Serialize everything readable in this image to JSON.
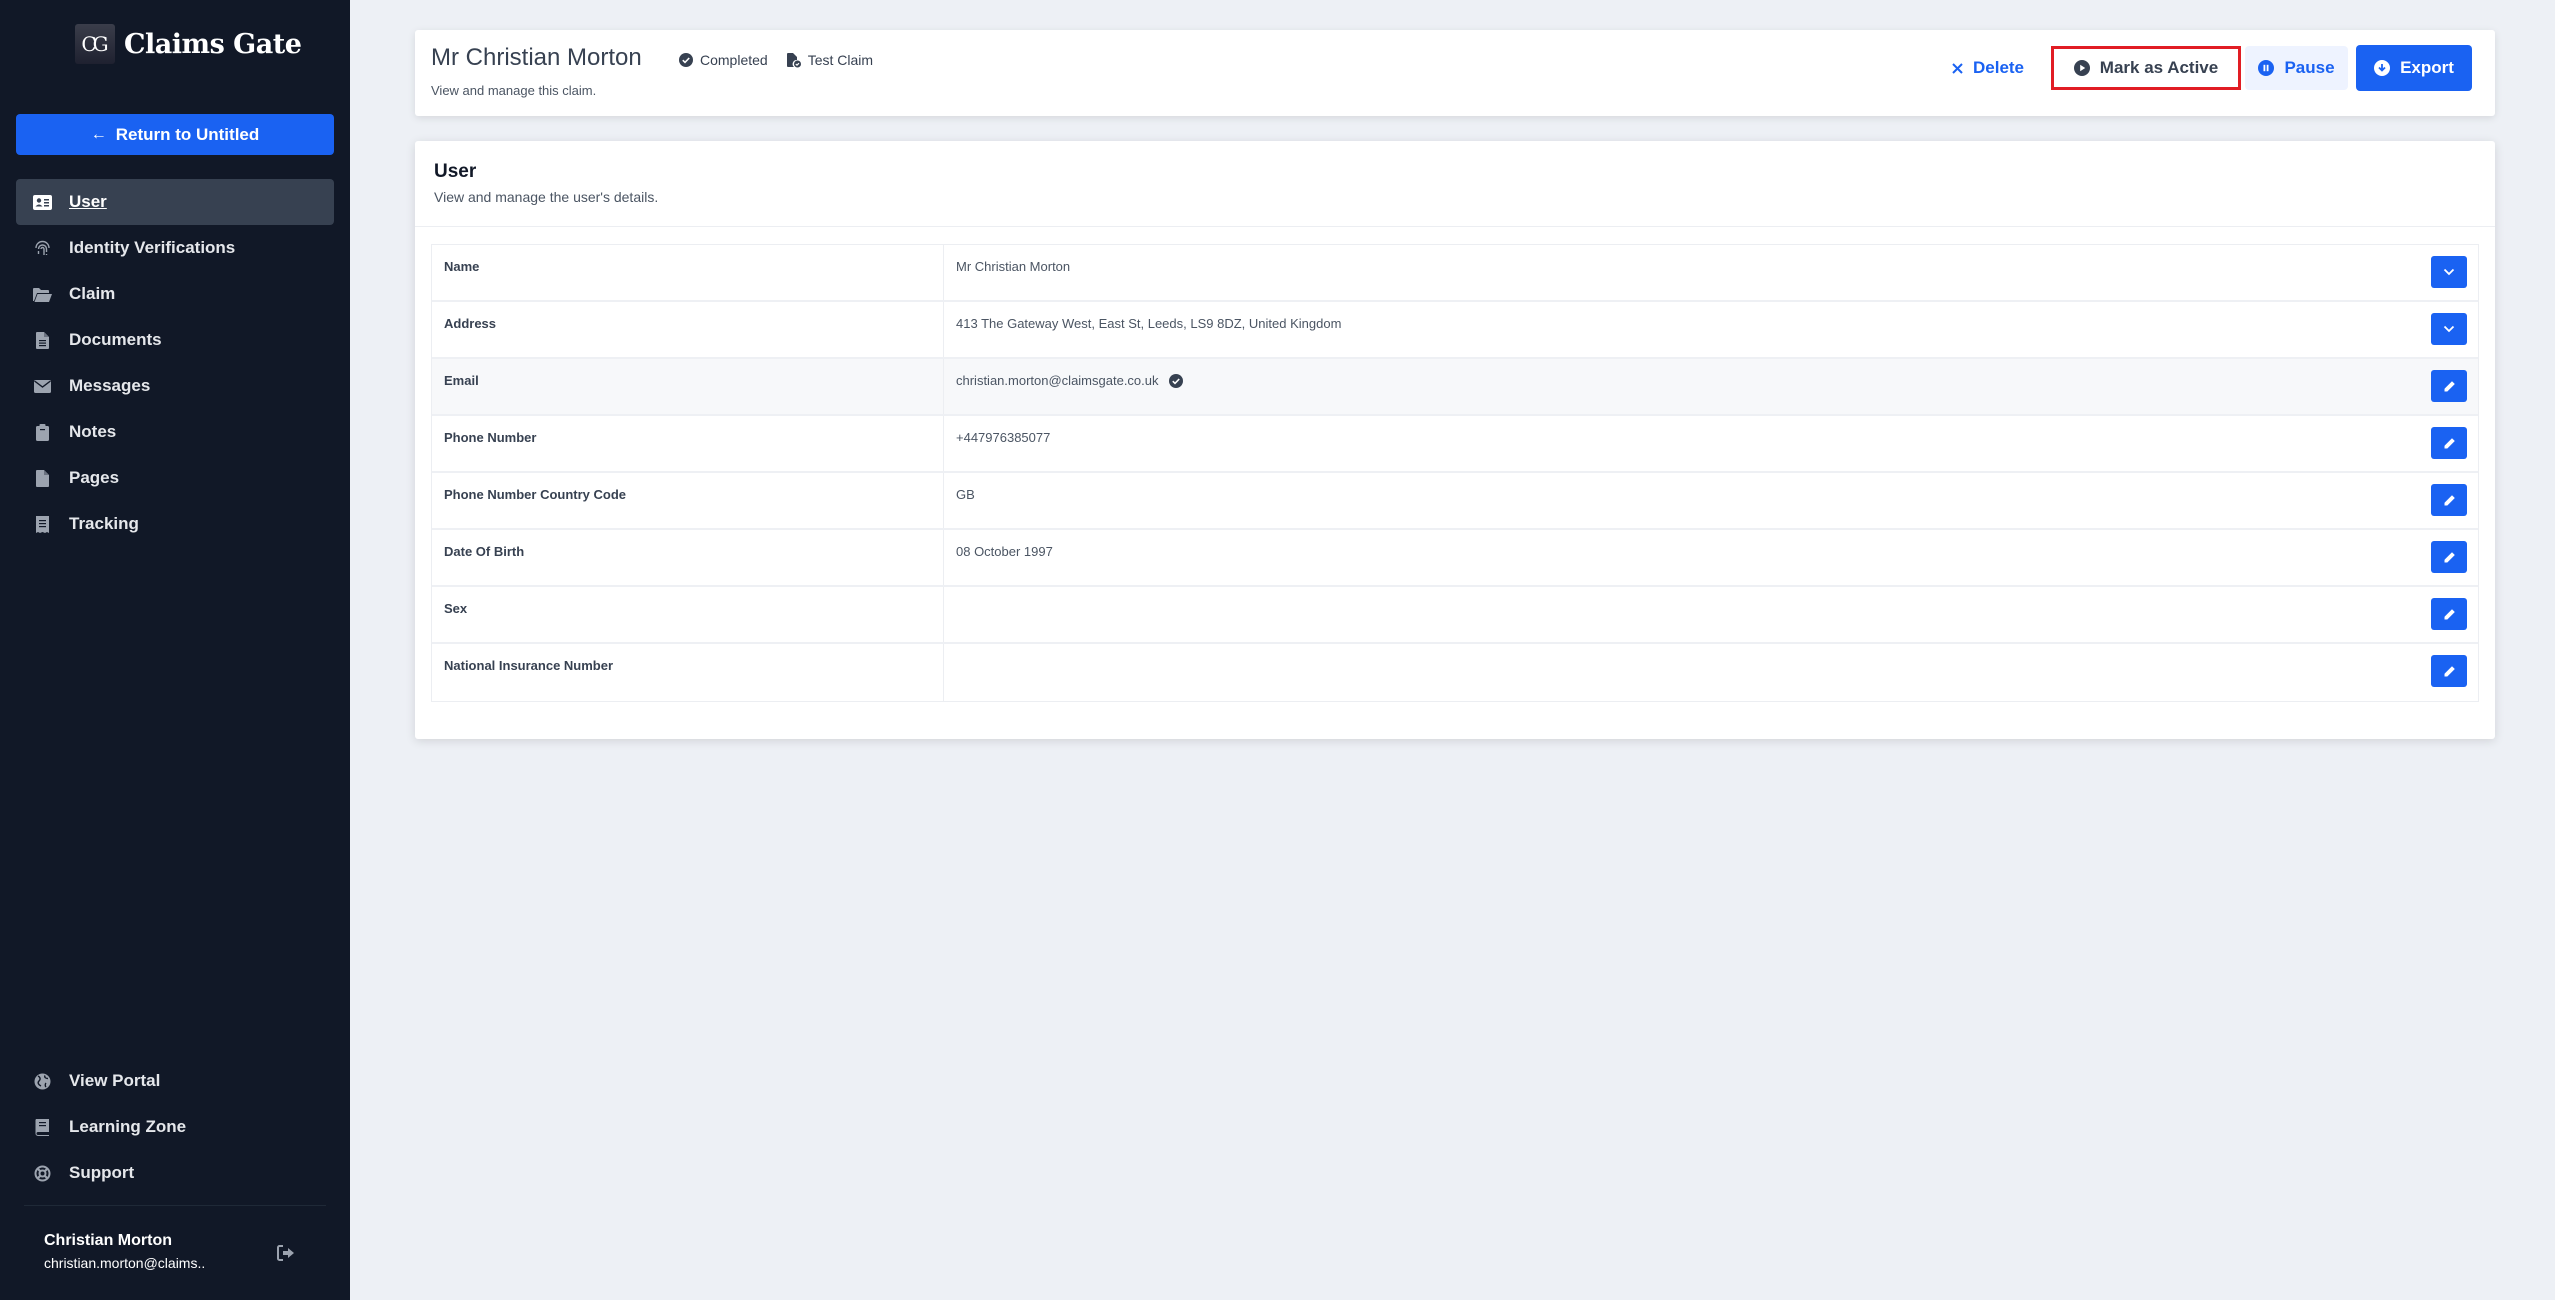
{
  "brand": {
    "logo_mark": "CG",
    "name": "Claims Gate"
  },
  "sidebar": {
    "return_button": "Return to Untitled",
    "items": [
      {
        "label": "User",
        "icon": "id-card-icon",
        "active": true
      },
      {
        "label": "Identity Verifications",
        "icon": "fingerprint-icon",
        "active": false
      },
      {
        "label": "Claim",
        "icon": "folder-open-icon",
        "active": false
      },
      {
        "label": "Documents",
        "icon": "file-lines-icon",
        "active": false
      },
      {
        "label": "Messages",
        "icon": "envelope-icon",
        "active": false
      },
      {
        "label": "Notes",
        "icon": "clipboard-icon",
        "active": false
      },
      {
        "label": "Pages",
        "icon": "file-icon",
        "active": false
      },
      {
        "label": "Tracking",
        "icon": "receipt-icon",
        "active": false
      }
    ],
    "bottom_items": [
      {
        "label": "View Portal",
        "icon": "globe-icon"
      },
      {
        "label": "Learning Zone",
        "icon": "book-icon"
      },
      {
        "label": "Support",
        "icon": "life-ring-icon"
      }
    ],
    "profile": {
      "name": "Christian Morton",
      "email": "christian.morton@claims.."
    }
  },
  "header": {
    "title": "Mr Christian Morton",
    "status": "Completed",
    "tag": "Test Claim",
    "subtitle": "View and manage this claim.",
    "actions": {
      "delete": "Delete",
      "mark_active": "Mark as Active",
      "pause": "Pause",
      "export": "Export"
    }
  },
  "user_card": {
    "title": "User",
    "subtitle": "View and manage the user's details.",
    "rows": [
      {
        "label": "Name",
        "value": "Mr Christian Morton",
        "action": "expand",
        "verified": false
      },
      {
        "label": "Address",
        "value": "413 The Gateway West, East St, Leeds, LS9 8DZ, United Kingdom",
        "action": "expand",
        "verified": false
      },
      {
        "label": "Email",
        "value": "christian.morton@claimsgate.co.uk",
        "action": "edit",
        "verified": true
      },
      {
        "label": "Phone Number",
        "value": "+447976385077",
        "action": "edit",
        "verified": false
      },
      {
        "label": "Phone Number Country Code",
        "value": "GB",
        "action": "edit",
        "verified": false
      },
      {
        "label": "Date Of Birth",
        "value": "08 October 1997",
        "action": "edit",
        "verified": false
      },
      {
        "label": "Sex",
        "value": "",
        "action": "edit",
        "verified": false
      },
      {
        "label": "National Insurance Number",
        "value": "",
        "action": "edit",
        "verified": false
      }
    ]
  },
  "colors": {
    "primary": "#1a62f2",
    "sidebar_bg": "#111827",
    "sidebar_active": "#374151",
    "highlight_outline": "#e11d24",
    "page_bg": "#edf0f5"
  }
}
